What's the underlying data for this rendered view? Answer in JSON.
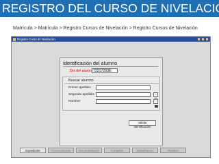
{
  "slide": {
    "title": "REGISTRO DEL CURSO DE NIVELACIÓN",
    "breadcrumb": "Matrícula > Matrícula > Registro Cursos de Nivelación > Registro Cursos de Nivelación"
  },
  "app": {
    "window_title": "Registro Curso de Nivelación",
    "identification": {
      "title": "Identificación del alumno",
      "dni_label": "Dni del alumno:",
      "dni_value": "72317293E"
    },
    "search": {
      "title": "Buscar alumno",
      "fields": [
        {
          "label": "Primer apellido:",
          "value": ""
        },
        {
          "label": "Segundo apellido:",
          "value": ""
        },
        {
          "label": "Nombre:",
          "value": ""
        }
      ],
      "validate_label": "Validar identificación"
    },
    "tabs": [
      {
        "label": "Expediente",
        "active": true
      },
      {
        "label": "Convocatorias",
        "active": false
      },
      {
        "label": "Documentación",
        "active": false
      },
      {
        "label": "Cursados",
        "active": false
      },
      {
        "label": "Estadísticas",
        "active": false
      },
      {
        "label": "Recibos",
        "active": false
      }
    ]
  },
  "colors": {
    "title_bar": "#1f6fb5",
    "window_titlebar": "#2b4d9a",
    "required_label": "#cc0000"
  }
}
